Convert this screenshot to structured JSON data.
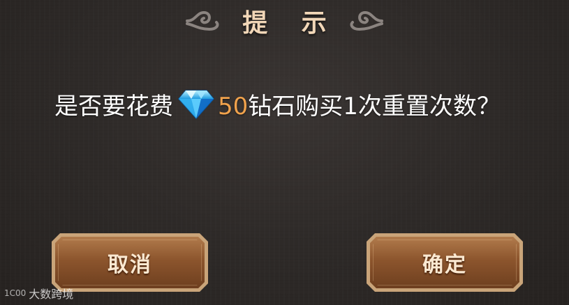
{
  "dialog": {
    "title": "提 示",
    "message_prefix": "是否要花费",
    "currency_icon": "diamond-icon",
    "amount": "50",
    "message_suffix": "钻石购买1次重置次数？",
    "colors": {
      "title": "#f2d7b8",
      "amount": "#f0a24c",
      "button_fill": "#8c552d",
      "button_border": "#c9a479"
    }
  },
  "buttons": {
    "cancel_label": "取消",
    "confirm_label": "确定"
  },
  "watermark": {
    "logo_text": "1C00",
    "text": "大数跨境"
  }
}
